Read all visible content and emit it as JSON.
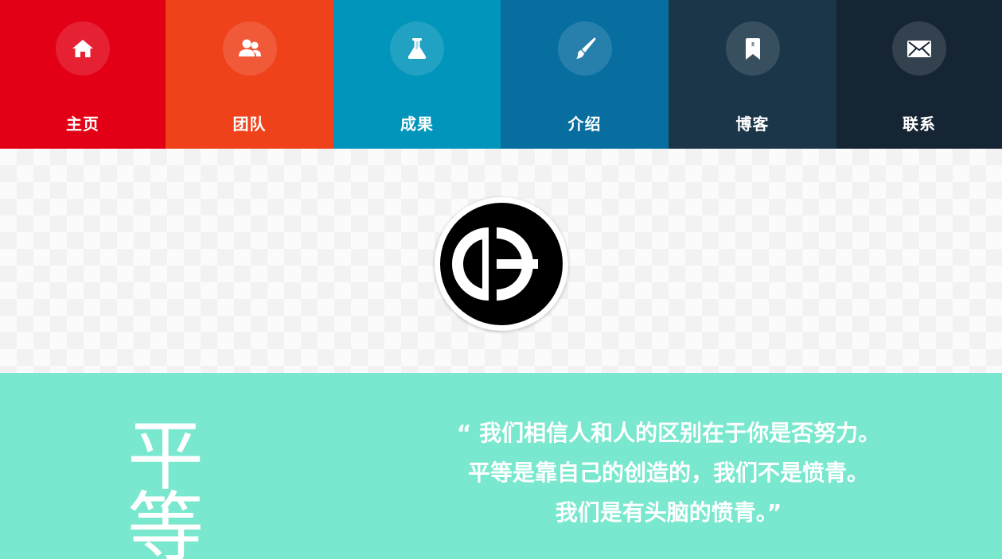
{
  "nav": {
    "items": [
      {
        "label": "主页",
        "icon": "home-icon",
        "color": "#e30016"
      },
      {
        "label": "团队",
        "icon": "team-icon",
        "color": "#ef421b"
      },
      {
        "label": "成果",
        "icon": "flask-icon",
        "color": "#0195bb"
      },
      {
        "label": "介绍",
        "icon": "brush-icon",
        "color": "#086ea0"
      },
      {
        "label": "博客",
        "icon": "bookmark-icon",
        "color": "#1b3549"
      },
      {
        "label": "联系",
        "icon": "envelope-icon",
        "color": "#162534"
      }
    ]
  },
  "hero": {
    "logo": "dh-logo",
    "background": "#fbfbfb"
  },
  "motto": {
    "background": "#79e8ce",
    "big_chars": [
      "平",
      "等"
    ],
    "quote_lines": [
      "“ 我们相信人和人的区别在于你是否努力。",
      "平等是靠自己的创造的，我们不是愤青。",
      "我们是有头脑的愤青。”"
    ]
  }
}
